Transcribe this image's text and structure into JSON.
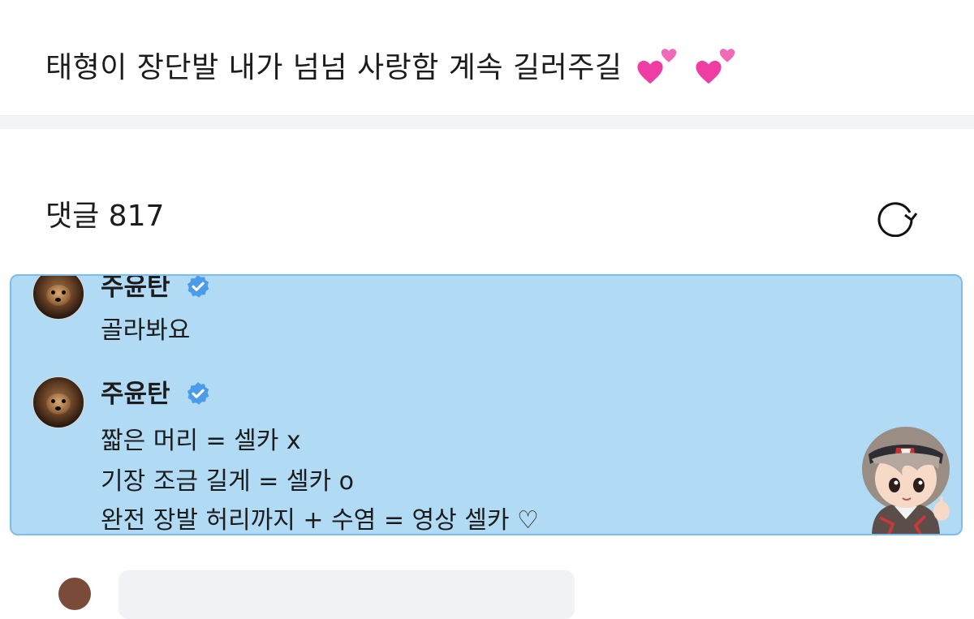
{
  "post": {
    "text": "태형이 장단발 내가 넘넘 사랑함 계속 길러주길",
    "emoji": [
      "two-hearts",
      "two-hearts"
    ]
  },
  "comments_section": {
    "label": "댓글 817",
    "refresh_icon": "refresh-icon"
  },
  "comments": [
    {
      "username": "주윤탄",
      "verified": true,
      "lines": [
        "골라봐요"
      ]
    },
    {
      "username": "주윤탄",
      "verified": true,
      "lines": [
        "짧은 머리 = 셀카 x",
        "기장 조금 길게 = 셀카 o",
        "완전 장발 허리까지 + 수염 = 영상 셀카 ♡"
      ]
    }
  ],
  "colors": {
    "highlight_bg": "#b1daf4",
    "highlight_border": "#7fbce8",
    "verified_badge": "#4a9be8",
    "heart": "#ee3ea4"
  },
  "sticker": "chibi-character-sticker"
}
